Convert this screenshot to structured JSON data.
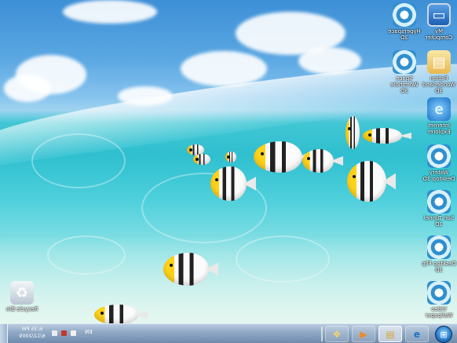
{
  "desktop": {
    "icons": [
      {
        "name": "my-computer-icon",
        "label": "My Computer",
        "glyph": "▭"
      },
      {
        "name": "hyperspace-3d-icon",
        "label": "Hyperspace 3D",
        "glyph": "✺"
      },
      {
        "name": "folder-icon",
        "label": "Fiction Wonderland 3D",
        "glyph": "▤"
      },
      {
        "name": "space-wormhole-icon",
        "label": "Space Wormhole 3D",
        "glyph": "✺"
      },
      {
        "name": "internet-explorer-icon",
        "label": "Internet Explorer",
        "glyph": "e"
      },
      {
        "name": "watery-desktop-icon",
        "label": "Watery Desktop 3D",
        "glyph": "✺"
      },
      {
        "name": "sun-tunnel-icon",
        "label": "Sun Tunnel 3D",
        "glyph": "✺"
      },
      {
        "name": "desktop-flip-icon",
        "label": "Desktop Flip 3D",
        "glyph": "✺"
      },
      {
        "name": "video-wallpaper-icon",
        "label": "Video Wallpaper",
        "glyph": "✺"
      },
      {
        "name": "recycle-bin-icon",
        "label": "Recycle Bin",
        "glyph": "♻"
      }
    ]
  },
  "taskbar": {
    "start_glyph": "⊞",
    "buttons": [
      {
        "name": "taskbar-ie-button",
        "glyph": "e"
      },
      {
        "name": "taskbar-explorer-button",
        "glyph": "▤"
      },
      {
        "name": "taskbar-media-player-button",
        "glyph": "▶"
      },
      {
        "name": "taskbar-desktop-3d-button",
        "glyph": "❖"
      }
    ],
    "language": "EN",
    "clock_time": "6:35 PM",
    "clock_date": "6/12/2009"
  },
  "colors": {
    "sky": "#3d8fd6",
    "water": "#2fbfcf",
    "taskbar": "#8ea7c4",
    "fish_yellow": "#ffd21a"
  }
}
